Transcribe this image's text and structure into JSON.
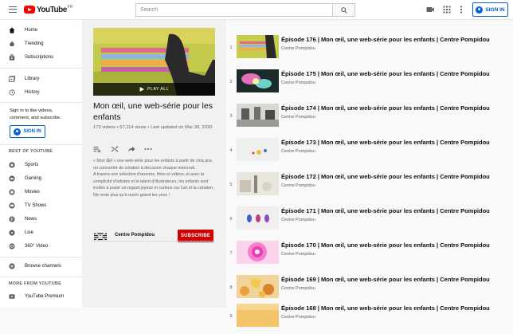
{
  "header": {
    "logo_text": "YouTube",
    "logo_country": "FR",
    "search_placeholder": "Search",
    "signin_label": "SIGN IN"
  },
  "sidebar": {
    "primary": [
      {
        "label": "Home",
        "icon": "home-icon"
      },
      {
        "label": "Trending",
        "icon": "trending-icon"
      },
      {
        "label": "Subscriptions",
        "icon": "subscriptions-icon"
      }
    ],
    "secondary": [
      {
        "label": "Library",
        "icon": "library-icon"
      },
      {
        "label": "History",
        "icon": "history-icon"
      }
    ],
    "promo_text": "Sign in to like videos, comment, and subscribe.",
    "signin_label": "SIGN IN",
    "best_heading": "BEST OF YOUTUBE",
    "best": [
      {
        "label": "Sports",
        "icon": "sports-icon"
      },
      {
        "label": "Gaming",
        "icon": "gaming-icon"
      },
      {
        "label": "Movies",
        "icon": "movies-icon"
      },
      {
        "label": "TV Shows",
        "icon": "tv-shows-icon"
      },
      {
        "label": "News",
        "icon": "news-icon"
      },
      {
        "label": "Live",
        "icon": "live-icon"
      },
      {
        "label": "360° Video",
        "icon": "360-video-icon"
      }
    ],
    "browse_label": "Browse channels",
    "more_heading": "MORE FROM YOUTUBE",
    "premium_label": "YouTube Premium"
  },
  "playlist": {
    "play_all": "PLAY ALL",
    "title": "Mon œil, une web-série pour les enfants",
    "meta": "173 videos • 57,114 views • Last updated on Mar 30, 2020",
    "description": "« Mon Œil » une web-série pour les enfants à partir de cinq ans, un concentré de création à découvrir chaque mercredi.\nA travers une sélection d'œuvres, films et vidéos, et avec la complicité d'artistes et le talent d'illustrateurs, les enfants sont invités à poser un regard joyeux et curieux sur l'art et la création. Ne reste plus qu'à ouvrir grand les yeux !",
    "owner": "Centre Pompidou",
    "subscribe_label": "SUBSCRIBE"
  },
  "videos": [
    {
      "index": "1",
      "title": "Épisode 176 | Mon œil, une web-série pour les enfants | Centre Pompidou",
      "channel": "Centre Pompidou"
    },
    {
      "index": "2",
      "title": "Épisode 175 | Mon œil, une web-série pour les enfants | Centre Pompidou",
      "channel": "Centre Pompidou"
    },
    {
      "index": "3",
      "title": "Épisode 174 | Mon œil, une web-série pour les enfants | Centre Pompidou",
      "channel": "Centre Pompidou"
    },
    {
      "index": "4",
      "title": "Épisode 173 | Mon œil, une web-série pour les enfants | Centre Pompidou",
      "channel": "Centre Pompidou"
    },
    {
      "index": "5",
      "title": "Épisode 172 | Mon œil, une web-série pour les enfants | Centre Pompidou",
      "channel": "Centre Pompidou"
    },
    {
      "index": "6",
      "title": "Épisode 171 | Mon œil, une web-série pour les enfants | Centre Pompidou",
      "channel": "Centre Pompidou"
    },
    {
      "index": "7",
      "title": "Épisode 170 | Mon œil, une web-série pour les enfants | Centre Pompidou",
      "channel": "Centre Pompidou"
    },
    {
      "index": "8",
      "title": "Épisode 169 | Mon œil, une web-série pour les enfants | Centre Pompidou",
      "channel": "Centre Pompidou"
    },
    {
      "index": "9",
      "title": "Épisode 168 | Mon œil, une web-série pour les enfants | Centre Pompidou",
      "channel": "Centre Pompidou"
    }
  ]
}
